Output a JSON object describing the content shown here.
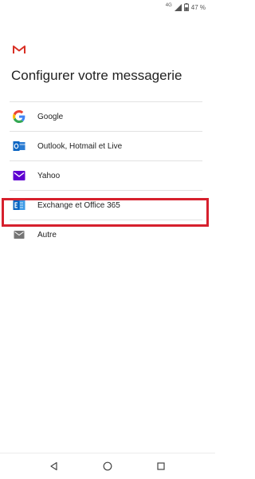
{
  "status_bar": {
    "network": "4G",
    "battery_percent": "47 %"
  },
  "app": {
    "logo": "gmail-logo"
  },
  "page": {
    "title": "Configurer votre messagerie"
  },
  "providers": [
    {
      "label": "Google",
      "icon": "google-icon"
    },
    {
      "label": "Outlook, Hotmail et Live",
      "icon": "outlook-icon"
    },
    {
      "label": "Yahoo",
      "icon": "yahoo-icon"
    },
    {
      "label": "Exchange et Office 365",
      "icon": "exchange-icon"
    },
    {
      "label": "Autre",
      "icon": "mail-icon"
    }
  ],
  "highlight": {
    "item": "Autre",
    "color": "#d6202d"
  },
  "navigation": {
    "buttons": [
      "back-icon",
      "home-icon",
      "recents-icon"
    ]
  }
}
